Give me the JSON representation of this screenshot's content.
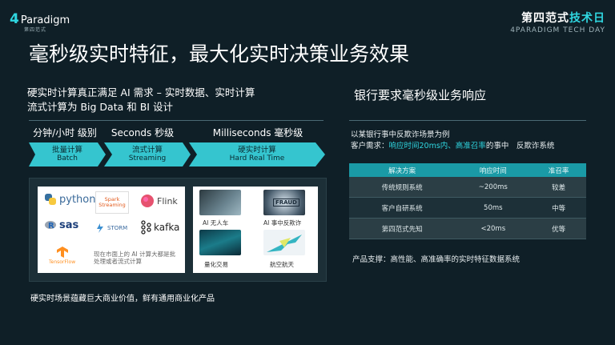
{
  "header": {
    "logo_mark": "4",
    "logo_word": "Paradigm",
    "logo_sub": "第四范式",
    "brand_cn_a": "第四范式",
    "brand_cn_b": "技术日",
    "brand_en": "4PARADIGM TECH DAY"
  },
  "title": "毫秒级实时特征，最大化实时决策业务效果",
  "left": {
    "lead_line1": "硬实时计算真正满足 AI 需求 – 实时数据、实时计算",
    "lead_line2": "流式计算为 Big Data 和 BI 设计",
    "tiers": [
      {
        "label": "分钟/小时 级别",
        "cn": "批量计算",
        "en": "Batch"
      },
      {
        "label": "Seconds 秒级",
        "cn": "流式计算",
        "en": "Streaming"
      },
      {
        "label": "Milliseconds 毫秒级",
        "cn": "硬实时计算",
        "en": "Hard Real Time"
      }
    ],
    "techs": {
      "python": "python",
      "spark": "Spark Streaming",
      "flink": "Flink",
      "sas": "sas",
      "storm": "STORM",
      "kafka": "kafka",
      "tensorflow": "TensorFlow"
    },
    "note": "现在市面上的 AI 计算大都是批处理或者流式计算",
    "apps": [
      {
        "caption": "AI 无人车"
      },
      {
        "caption": "AI 事中反欺诈"
      },
      {
        "caption": "量化交易"
      },
      {
        "caption": "航空航天"
      }
    ],
    "fraud_label": "FRAUD",
    "bottom": "硬实时场景蕴藏巨大商业价值，鲜有通用商业化产品"
  },
  "right": {
    "title": "银行要求毫秒级业务响应",
    "example": "以某银行事中反欺诈场景为例",
    "req_prefix": "客户需求：",
    "req_highlight": "响应时间20ms内、高准召率",
    "req_suffix": "的事中　反欺诈系统",
    "table": {
      "headers": [
        "解决方案",
        "响应时间",
        "准召率"
      ],
      "rows": [
        [
          "传统规则系统",
          "~200ms",
          "较差"
        ],
        [
          "客户自研系统",
          "50ms",
          "中等"
        ],
        [
          "第四范式先知",
          "<20ms",
          "优等"
        ]
      ]
    },
    "footer": "产品支撑：高性能、高准确率的实时特征数据系统"
  },
  "colors": {
    "background": "#0f1f27",
    "accent": "#2fd6e0",
    "table_header": "#1a9aa6",
    "highlight": "#2fd6e0"
  }
}
